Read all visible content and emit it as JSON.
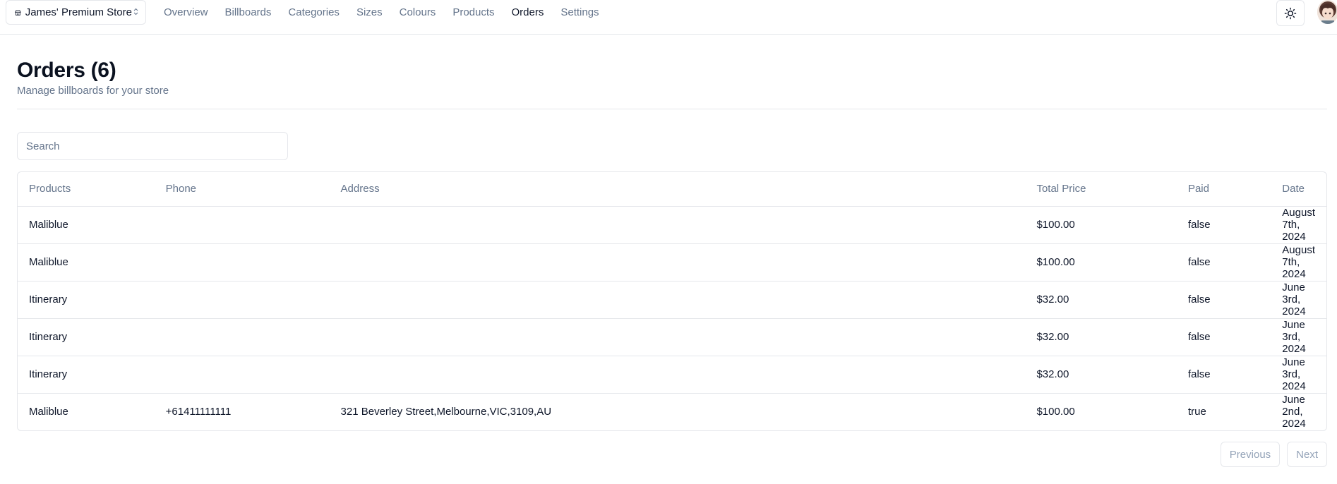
{
  "header": {
    "store_name": "James' Premium Store",
    "nav": [
      {
        "label": "Overview"
      },
      {
        "label": "Billboards"
      },
      {
        "label": "Categories"
      },
      {
        "label": "Sizes"
      },
      {
        "label": "Colours"
      },
      {
        "label": "Products"
      },
      {
        "label": "Orders"
      },
      {
        "label": "Settings"
      }
    ],
    "active_nav": "Orders"
  },
  "page": {
    "title": "Orders (6)",
    "subtitle": "Manage billboards for your store"
  },
  "search": {
    "placeholder": "Search",
    "value": ""
  },
  "table": {
    "columns": [
      "Products",
      "Phone",
      "Address",
      "Total Price",
      "Paid",
      "Date"
    ],
    "rows": [
      {
        "products": "Maliblue",
        "phone": "",
        "address": "",
        "total_price": "$100.00",
        "paid": "false",
        "date": "August 7th, 2024"
      },
      {
        "products": "Maliblue",
        "phone": "",
        "address": "",
        "total_price": "$100.00",
        "paid": "false",
        "date": "August 7th, 2024"
      },
      {
        "products": "Itinerary",
        "phone": "",
        "address": "",
        "total_price": "$32.00",
        "paid": "false",
        "date": "June 3rd, 2024"
      },
      {
        "products": "Itinerary",
        "phone": "",
        "address": "",
        "total_price": "$32.00",
        "paid": "false",
        "date": "June 3rd, 2024"
      },
      {
        "products": "Itinerary",
        "phone": "",
        "address": "",
        "total_price": "$32.00",
        "paid": "false",
        "date": "June 3rd, 2024"
      },
      {
        "products": "Maliblue",
        "phone": "+61411111111",
        "address": "321 Beverley Street,Melbourne,VIC,3109,AU",
        "total_price": "$100.00",
        "paid": "true",
        "date": "June 2nd, 2024"
      }
    ]
  },
  "pagination": {
    "previous_label": "Previous",
    "next_label": "Next"
  },
  "icons": {
    "store": "store-icon",
    "switcher": "chevrons-up-down-icon",
    "theme": "sun-icon"
  },
  "colors": {
    "text": "#0f172a",
    "muted": "#64748b",
    "border": "#e5e7eb",
    "disabled": "#94a3b8"
  }
}
